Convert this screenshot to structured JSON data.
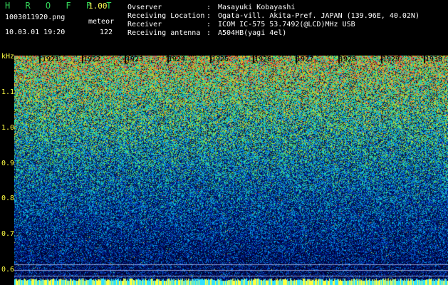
{
  "header": {
    "app_name": "H R O F F T",
    "version": "1.00",
    "filename": "1003011920.png",
    "meteor_label": "meteor",
    "datetime": "10.03.01 19:20",
    "meteor_count": "122",
    "info": [
      {
        "label": "Ovserver",
        "sep": ":",
        "value": "Masayuki Kobayashi"
      },
      {
        "label": "Receiving Location",
        "sep": ":",
        "value": "Ogata-vill. Akita-Pref. JAPAN (139.96E, 40.02N)"
      },
      {
        "label": "Receiver",
        "sep": ":",
        "value": "ICOM IC-575 53.7492(@LCD)MHz USB"
      },
      {
        "label": "Receiving antenna",
        "sep": ":",
        "value": "A504HB(yagi 4el)"
      }
    ]
  },
  "axes": {
    "unit": "kHz",
    "y_ticks": [
      "1.1",
      "1.0",
      "0.9",
      "0.8",
      "0.7",
      "0.6"
    ],
    "x_ticks": [
      "1921",
      "1922",
      "1923",
      "1924",
      "1925",
      "1926",
      "1927",
      "1928",
      "1929",
      "1930"
    ]
  },
  "colors": {
    "background": "#000000",
    "label": "#ffff33",
    "title": "#34d65a",
    "text": "#ffffff"
  }
}
